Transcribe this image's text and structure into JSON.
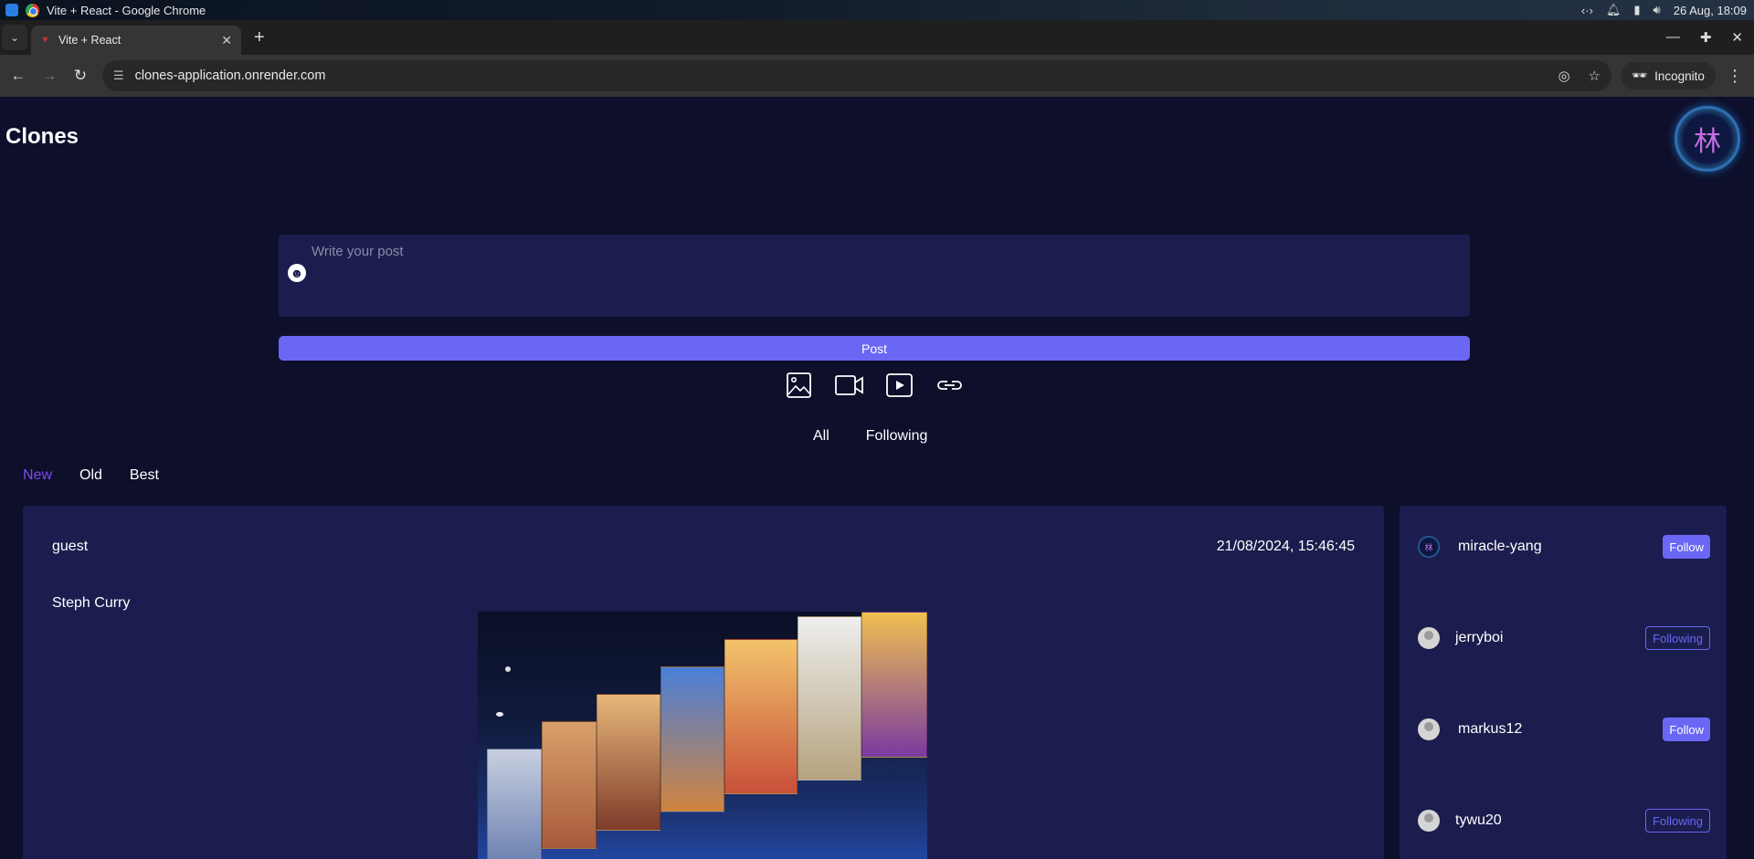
{
  "os": {
    "window_title": "Vite + React - Google Chrome",
    "datetime": "26 Aug, 18:09"
  },
  "browser": {
    "tab_title": "Vite + React",
    "url": "clones-application.onrender.com",
    "incognito_label": "Incognito"
  },
  "app": {
    "brand": "Clones",
    "profile_glyph": "林",
    "composer": {
      "placeholder": "Write your post",
      "post_button": "Post"
    },
    "media_icons": [
      "image-icon",
      "video-icon",
      "play-icon",
      "link-icon"
    ],
    "feed_tabs": [
      "All",
      "Following"
    ],
    "sort_tabs": {
      "new": "New",
      "old": "Old",
      "best": "Best",
      "active": "New"
    },
    "post": {
      "author": "guest",
      "timestamp": "21/08/2024, 15:46:45",
      "text": "Steph Curry"
    },
    "suggested_users": [
      {
        "name": "miracle-yang",
        "button": "Follow",
        "state": "follow"
      },
      {
        "name": "jerryboi",
        "button": "Following",
        "state": "following"
      },
      {
        "name": "markus12",
        "button": "Follow",
        "state": "follow"
      },
      {
        "name": "tywu20",
        "button": "Following",
        "state": "following"
      }
    ],
    "colors": {
      "background": "#0e0f2a",
      "card": "#1b1d4e",
      "accent": "#6a67f5",
      "active_tab": "#7d4cf0"
    }
  }
}
